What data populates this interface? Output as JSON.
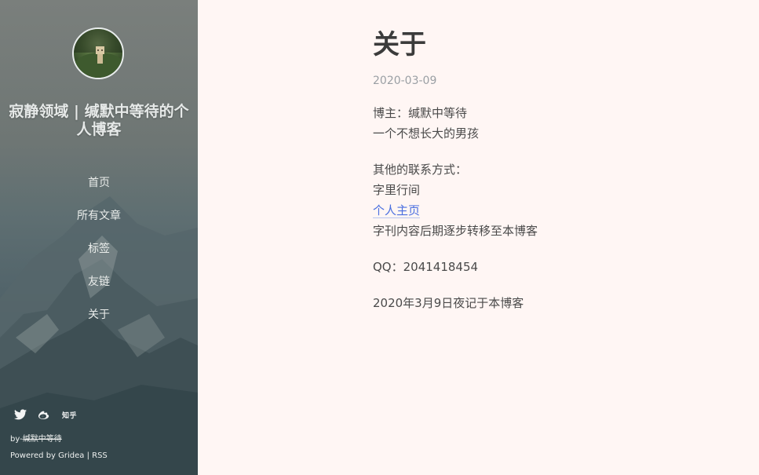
{
  "sidebar": {
    "site_title": "寂静领域 | 缄默中等待的个人博客",
    "nav": [
      "首页",
      "所有文章",
      "标签",
      "友链",
      "关于"
    ],
    "social": {
      "zhihu_label": "知乎"
    },
    "footer": {
      "by_prefix": "by-",
      "author": "缄默中等待",
      "powered": "Powered by Gridea | RSS"
    }
  },
  "post": {
    "title": "关于",
    "date": "2020-03-09",
    "blogger_line": "博主：缄默中等待",
    "tagline": "一个不想长大的男孩",
    "contact_heading": "其他的联系方式：",
    "contact_site": "字里行间",
    "homepage_link": "个人主页",
    "migration_note": "字刊内容后期逐步转移至本博客",
    "qq": "QQ：2041418454",
    "signoff": "2020年3月9日夜记于本博客"
  },
  "colors": {
    "page_bg": "#fff6f4",
    "link": "#4a6fe0",
    "date": "#9a9fa4"
  },
  "icons": [
    "twitter-icon",
    "weibo-icon"
  ]
}
